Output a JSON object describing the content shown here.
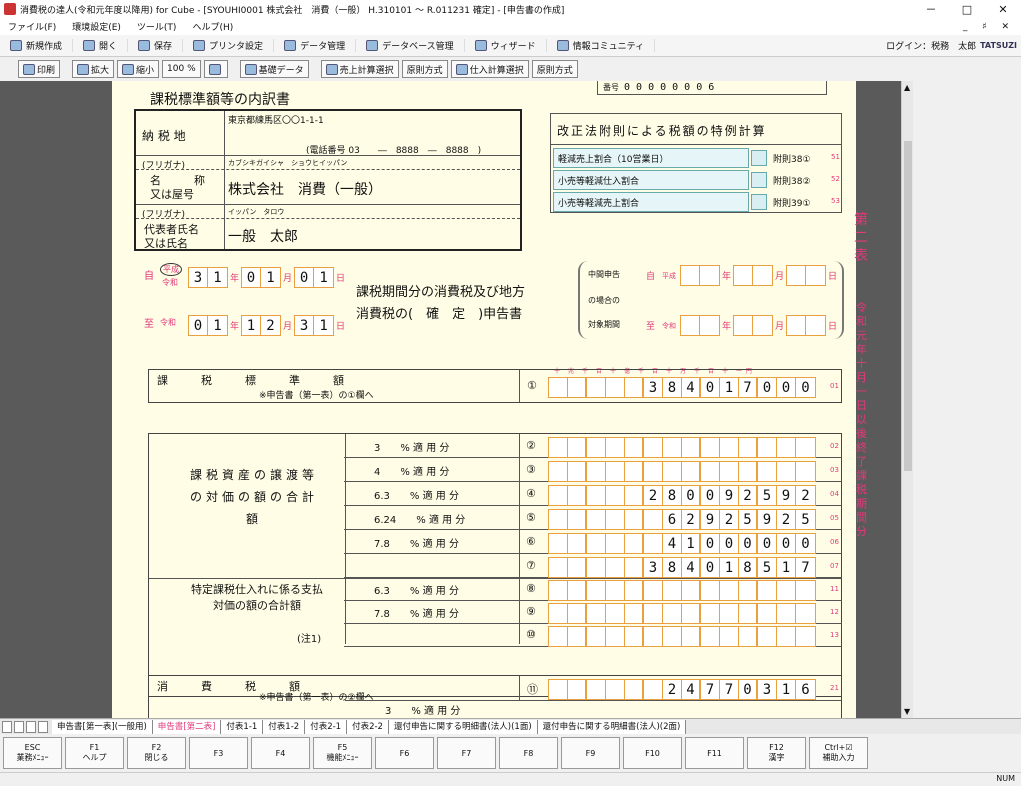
{
  "window": {
    "title": "消費税の達人(令和元年度以降用) for Cube - [SYOUHI0001 株式会社　消費（一般） H.310101 ～ R.011231 確定] - [申告書の作成]",
    "min": "－",
    "max": "□",
    "close": "✕"
  },
  "menu": {
    "items": [
      "ファイル(F)",
      "環境設定(E)",
      "ツール(T)",
      "ヘルプ(H)"
    ],
    "right": "_ ♯ ✕"
  },
  "toolbar1": {
    "items": [
      "新規作成",
      "開く",
      "保存",
      "プリンタ設定",
      "データ管理",
      "データベース管理",
      "ウィザード",
      "情報コミュニティ"
    ],
    "login": "ログイン：税務　太郎",
    "logo": "TATSUZI"
  },
  "toolbar2": {
    "items": [
      "印刷",
      "拡大",
      "縮小",
      "100 %",
      "",
      "基礎データ",
      "売上計算選択",
      "原則方式",
      "仕入計算選択",
      "原則方式"
    ]
  },
  "form": {
    "top_label": "番号",
    "top_digits": [
      "0",
      "0",
      "0",
      "0",
      "0",
      "0",
      "0",
      "6"
    ],
    "heading": "課税標準額等の内訳書",
    "address_label": "納 税 地",
    "address": "東京都練馬区〇〇1-1-1",
    "phone": "(電話番号 03　　―　8888　―　8888　)",
    "furigana_label": "(フリガナ)",
    "company_kana": "カブシキガイシャ　ショウヒイッパン",
    "name_label1": "名　　　称",
    "name_label2": "又は屋号",
    "company": "株式会社　消費（一般）",
    "furigana_label2": "(フリガナ)",
    "rep_kana": "イッパン　タロウ",
    "rep_label1": "代表者氏名",
    "rep_label2": "又は氏名",
    "rep": "一般　太郎",
    "special_title": "改正法附則による税額の特例計算",
    "special_rows": [
      {
        "label": "軽減売上割合（10営業日）",
        "ref": "附則38①",
        "no": "51"
      },
      {
        "label": "小売等軽減仕入割合",
        "ref": "附則38②",
        "no": "52"
      },
      {
        "label": "小売等軽減売上割合",
        "ref": "附則39①",
        "no": "53"
      }
    ],
    "side_title": "第二表",
    "side_note": "令和元年十月一日以後終了課税期間分",
    "from_label": "自",
    "era_heisei": "平成",
    "era_reiwa": "令和",
    "from_y": [
      "3",
      "1"
    ],
    "from_m": [
      "0",
      "1"
    ],
    "from_d": [
      "0",
      "1"
    ],
    "to_label": "至",
    "to_y": [
      "0",
      "1"
    ],
    "to_m": [
      "1",
      "2"
    ],
    "to_d": [
      "3",
      "1"
    ],
    "nen": "年",
    "tsuki": "月",
    "hi": "日",
    "period_title1": "課税期間分の消費税及び地方",
    "period_title2": "消費税の(　確　定　)申告書",
    "interim1": "中間申告",
    "interim2": "の場合の",
    "interim3": "対象期間",
    "interim_from": "自",
    "interim_to": "至",
    "digit_header": "十　兆　千　百　十　億　千　百　十　万　千　百　十　一 円",
    "row01_label": "課　　　税　　　標　　　準　　　額",
    "row01_note": "※申告書（第一表）の①欄へ",
    "row01_circ": "①",
    "row01_val": "384017000",
    "row01_no": "01",
    "group1_label": "課税資産の譲渡等の対価の額の合計額",
    "group1_rows": [
      {
        "rate": "3　　% 適 用 分",
        "circ": "②",
        "val": "",
        "no": "02"
      },
      {
        "rate": "4　　% 適 用 分",
        "circ": "③",
        "val": "",
        "no": "03"
      },
      {
        "rate": "6.3　　% 適 用 分",
        "circ": "④",
        "val": "280092592",
        "no": "04"
      },
      {
        "rate": "6.24　　% 適 用 分",
        "circ": "⑤",
        "val": "62925925",
        "no": "05"
      },
      {
        "rate": "7.8　　% 適 用 分",
        "circ": "⑥",
        "val": "41000000",
        "no": "06"
      },
      {
        "rate": "",
        "circ": "⑦",
        "val": "384018517",
        "no": "07"
      }
    ],
    "group2_label": "特定課税仕入れに係る支払対価の額の合計額",
    "group2_note": "(注1)",
    "group2_rows": [
      {
        "rate": "6.3　　% 適 用 分",
        "circ": "⑧",
        "val": "",
        "no": "11"
      },
      {
        "rate": "7.8　　% 適 用 分",
        "circ": "⑨",
        "val": "",
        "no": "12"
      },
      {
        "rate": "",
        "circ": "⑩",
        "val": "",
        "no": "13"
      }
    ],
    "row21_label": "消　　　費　　　税　　　額",
    "row21_note": "※申告書（第一表）の②欄へ",
    "row21_circ": "⑪",
    "row21_val": "24770316",
    "row21_no": "21",
    "row22_rate": "3　　% 適 用 分"
  },
  "sheettabs": [
    "申告書[第一表](一般用)",
    "申告書[第二表]",
    "付表1-1",
    "付表1-2",
    "付表2-1",
    "付表2-2",
    "還付申告に関する明細書(法人)(1面)",
    "還付申告に関する明細書(法人)(2面)"
  ],
  "fkeys": [
    {
      "k": "ESC",
      "l": "業務ﾒﾆｭｰ"
    },
    {
      "k": "F1",
      "l": "ヘルプ"
    },
    {
      "k": "F2",
      "l": "閉じる"
    },
    {
      "k": "F3",
      "l": ""
    },
    {
      "k": "F4",
      "l": ""
    },
    {
      "k": "F5",
      "l": "機能ﾒﾆｭｰ"
    },
    {
      "k": "F6",
      "l": ""
    },
    {
      "k": "F7",
      "l": ""
    },
    {
      "k": "F8",
      "l": ""
    },
    {
      "k": "F9",
      "l": ""
    },
    {
      "k": "F10",
      "l": ""
    },
    {
      "k": "F11",
      "l": ""
    },
    {
      "k": "F12",
      "l": "漢字"
    },
    {
      "k": "Ctrl+☑",
      "l": "補助入力"
    }
  ],
  "status": {
    "num": "NUM"
  }
}
